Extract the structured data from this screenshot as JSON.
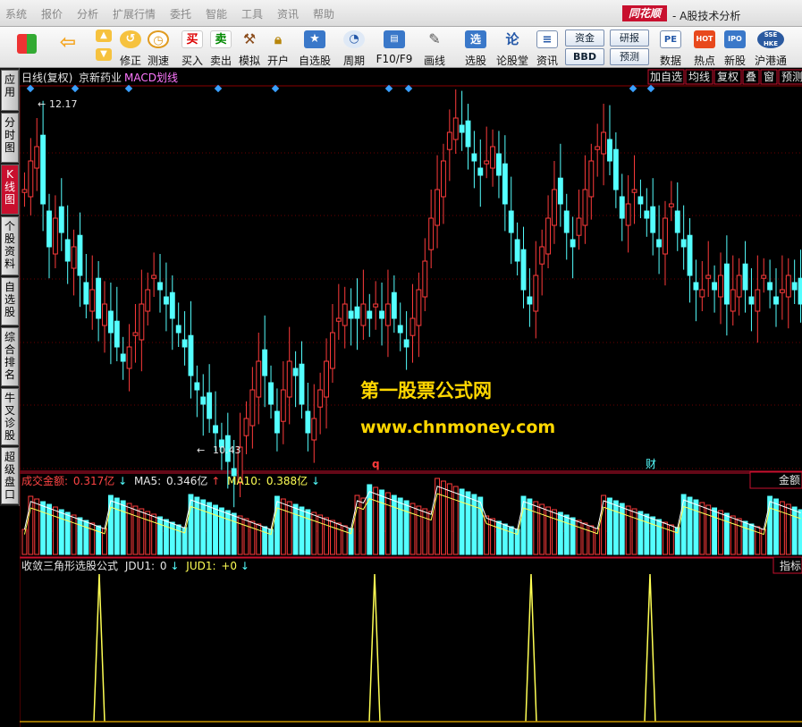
{
  "menu": [
    "系统",
    "报价",
    "分析",
    "扩展行情",
    "委托",
    "智能",
    "工具",
    "资讯",
    "帮助"
  ],
  "brand": "同花顺",
  "app_title": "- A股技术分析",
  "toolbar": {
    "buttons": [
      {
        "label": "",
        "icon": "start-grid-icon"
      },
      {
        "label": "",
        "icon": "back-arrow-icon"
      },
      {
        "label": "修正",
        "icon": "adjust-icon"
      },
      {
        "label": "测速",
        "icon": "stopwatch-icon"
      },
      {
        "label": "买入",
        "icon": "buy-icon"
      },
      {
        "label": "卖出",
        "icon": "sell-icon"
      },
      {
        "label": "模拟",
        "icon": "hammer-icon"
      },
      {
        "label": "开户",
        "icon": "lock-icon"
      },
      {
        "label": "自选股",
        "icon": "star-icon"
      },
      {
        "label": "周期",
        "icon": "clock-icon"
      },
      {
        "label": "F10/F9",
        "icon": "f10-icon"
      },
      {
        "label": "画线",
        "icon": "pencil-icon"
      },
      {
        "label": "选股",
        "icon": "stock-pick-icon"
      },
      {
        "label": "论股堂",
        "icon": "forum-icon"
      },
      {
        "label": "资讯",
        "icon": "news-icon"
      },
      {
        "label": "数据",
        "icon": "pe-data-icon"
      },
      {
        "label": "热点",
        "icon": "hot-icon"
      },
      {
        "label": "新股",
        "icon": "ipo-icon"
      },
      {
        "label": "沪港通",
        "icon": "hk-connect-icon"
      }
    ],
    "small_buttons": [
      "资金",
      "研报",
      "BBD",
      "预测"
    ],
    "buy_glyph": "买",
    "sell_glyph": "卖",
    "pe_glyph": "PE",
    "ipo_glyph": "IPO",
    "hk_glyph": "SSE HKE",
    "hot_glyph": "HOT",
    "forum_glyph": "论",
    "pick_glyph": "选"
  },
  "side_tabs": [
    "应用",
    "分时图",
    "K线图",
    "个股资料",
    "自选股",
    "综合排名",
    "牛叉诊股",
    "超级盘口"
  ],
  "chart": {
    "header": {
      "period": "日线(复权)",
      "stock": "京新药业",
      "indicator": "MACD划线"
    },
    "right_buttons": [
      "加自选",
      "均线",
      "复权",
      "叠",
      "窗",
      "预测"
    ],
    "high_label": "12.17",
    "low_label": "10.43",
    "marker_q": "q",
    "marker_cai": "财",
    "watermark_title": "第一股票公式网",
    "watermark_url": "www.chnmoney.com",
    "volume_panel": {
      "label": "成交金额:",
      "value": "0.317亿",
      "ma5_label": "MA5:",
      "ma5": "0.346亿",
      "ma10_label": "MA10:",
      "ma10": "0.388亿",
      "tab": "金额"
    },
    "indicator_panel": {
      "name": "收敛三角形选股公式",
      "jdu1_label": "JDU1:",
      "jdu1": "0",
      "jud1_label": "JUD1:",
      "jud1": "+0",
      "tab": "指标"
    },
    "colors": {
      "up": "#ff3b3b",
      "down": "#54ffff",
      "grid": "#8b0000",
      "yellow": "#ffff54",
      "white": "#e6e6e6"
    }
  }
}
